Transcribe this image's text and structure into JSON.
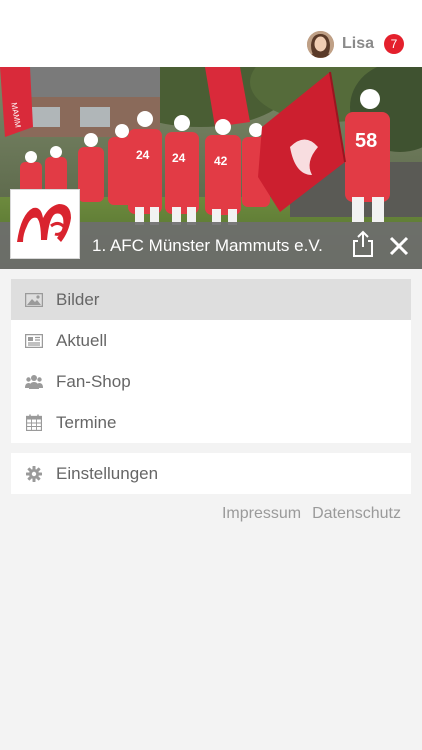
{
  "user": {
    "name": "Lisa",
    "notification_count": "7",
    "avatar_icon": "user-avatar"
  },
  "club": {
    "name": "1. AFC Münster Mammuts e.V."
  },
  "hero": {
    "jersey_numbers": [
      "24",
      "24",
      "42",
      "58"
    ]
  },
  "menu": {
    "items": [
      {
        "label": "Bilder",
        "icon": "image-icon",
        "active": true
      },
      {
        "label": "Aktuell",
        "icon": "newspaper-icon",
        "active": false
      },
      {
        "label": "Fan-Shop",
        "icon": "group-icon",
        "active": false
      },
      {
        "label": "Termine",
        "icon": "calendar-icon",
        "active": false
      }
    ],
    "settings": {
      "label": "Einstellungen",
      "icon": "gear-icon"
    }
  },
  "footer": {
    "impressum": "Impressum",
    "datenschutz": "Datenschutz"
  },
  "colors": {
    "accent_red": "#e4202c",
    "bar_gray": "#6e6e6e",
    "text_gray": "#666666"
  }
}
